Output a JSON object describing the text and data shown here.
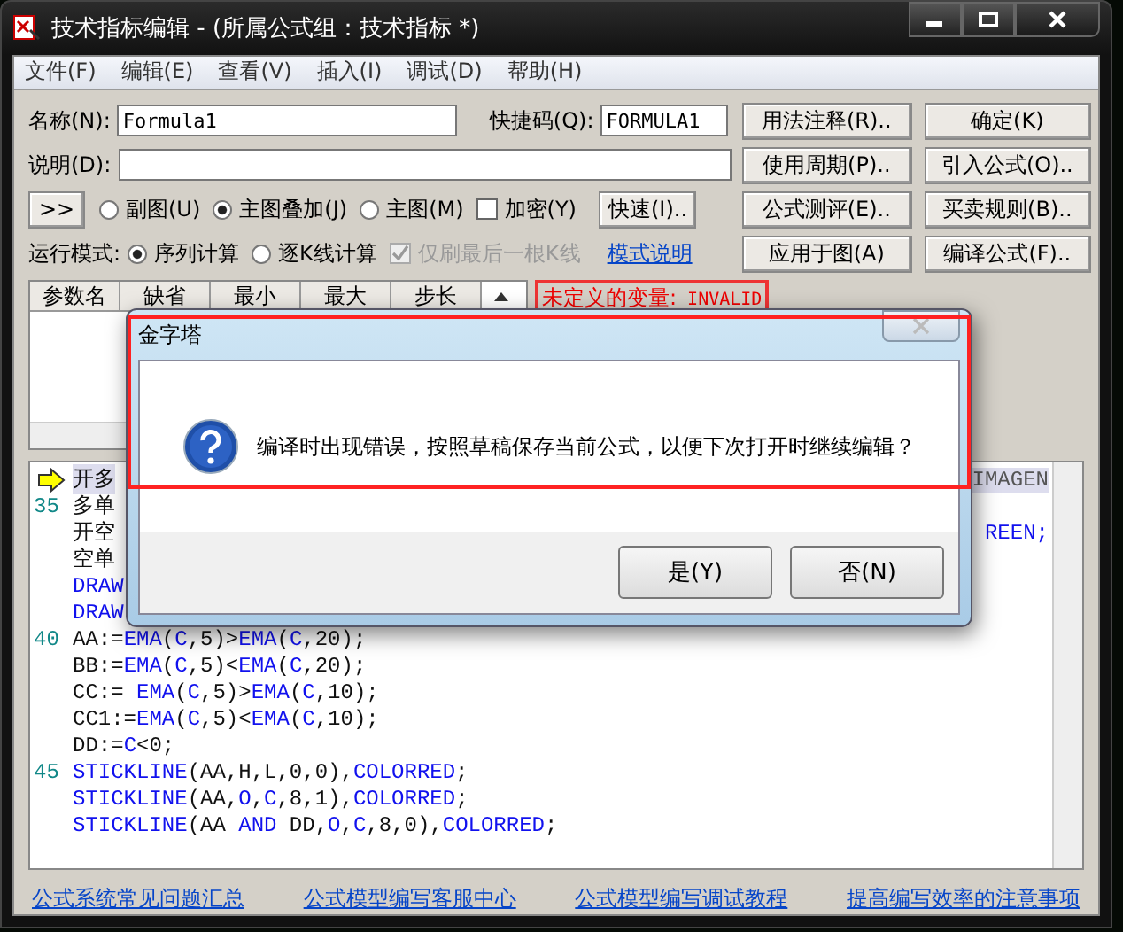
{
  "window": {
    "title": "技术指标编辑 - (所属公式组：技术指标 *)"
  },
  "menu": [
    "文件(F)",
    "编辑(E)",
    "查看(V)",
    "插入(I)",
    "调试(D)",
    "帮助(H)"
  ],
  "form": {
    "name_label": "名称(N):",
    "name_value": "Formula1",
    "shortcut_label": "快捷码(Q):",
    "shortcut_value": "FORMULA1",
    "desc_label": "说明(D):",
    "expand_button": ">>",
    "chart_options": [
      {
        "label": "副图(U)",
        "selected": false
      },
      {
        "label": "主图叠加(J)",
        "selected": true
      },
      {
        "label": "主图(M)",
        "selected": false
      }
    ],
    "encrypt": {
      "label": "加密(Y)",
      "checked": false
    },
    "quick_button": "快速(I)..",
    "run_mode_label": "运行模式:",
    "run_modes": [
      {
        "label": "序列计算",
        "selected": true
      },
      {
        "label": "逐K线计算",
        "selected": false
      }
    ],
    "refresh_last": {
      "label": "仅刷最后一根K线",
      "checked": true,
      "disabled": true
    },
    "mode_help_link": "模式说明"
  },
  "buttons": [
    [
      "用法注释(R)..",
      "确定(K)"
    ],
    [
      "使用周期(P)..",
      "引入公式(O).."
    ],
    [
      "公式测评(E)..",
      "买卖规则(B).."
    ],
    [
      "应用于图(A)",
      "编译公式(F).."
    ]
  ],
  "param_table": {
    "columns": [
      "参数名",
      "缺省",
      "最小",
      "最大",
      "步长"
    ]
  },
  "undefined_variable": {
    "label": "未定义的变量:",
    "value": "INVALID"
  },
  "code_lines": [
    {
      "current": true,
      "tokens": [
        {
          "text": "开多",
          "kind": "plain"
        }
      ],
      "tail": "IMAGEN"
    },
    {
      "number": "35",
      "current": false,
      "tokens": [
        {
          "text": "多单",
          "kind": "plain"
        }
      ]
    },
    {
      "current": false,
      "tokens": [
        {
          "text": "开空",
          "kind": "plain"
        }
      ],
      "tail": "REEN;"
    },
    {
      "current": false,
      "tokens": [
        {
          "text": "空单",
          "kind": "plain"
        }
      ]
    },
    {
      "current": false,
      "tokens": [
        {
          "text": "DRAW",
          "kind": "fn"
        }
      ]
    },
    {
      "current": false,
      "tokens": [
        {
          "text": "DRAW",
          "kind": "fn"
        }
      ]
    },
    {
      "number": "40",
      "current": false,
      "tokens": [
        {
          "text": "AA:=",
          "kind": "plain"
        },
        {
          "text": "EMA",
          "kind": "fn"
        },
        {
          "text": "(",
          "kind": "plain"
        },
        {
          "text": "C",
          "kind": "fn"
        },
        {
          "text": ",5)>",
          "kind": "plain"
        },
        {
          "text": "EMA",
          "kind": "fn"
        },
        {
          "text": "(",
          "kind": "plain"
        },
        {
          "text": "C",
          "kind": "fn"
        },
        {
          "text": ",20);",
          "kind": "plain"
        }
      ]
    },
    {
      "current": false,
      "tokens": [
        {
          "text": "BB:=",
          "kind": "plain"
        },
        {
          "text": "EMA",
          "kind": "fn"
        },
        {
          "text": "(",
          "kind": "plain"
        },
        {
          "text": "C",
          "kind": "fn"
        },
        {
          "text": ",5)<",
          "kind": "plain"
        },
        {
          "text": "EMA",
          "kind": "fn"
        },
        {
          "text": "(",
          "kind": "plain"
        },
        {
          "text": "C",
          "kind": "fn"
        },
        {
          "text": ",20);",
          "kind": "plain"
        }
      ]
    },
    {
      "current": false,
      "tokens": [
        {
          "text": "CC:= ",
          "kind": "plain"
        },
        {
          "text": "EMA",
          "kind": "fn"
        },
        {
          "text": "(",
          "kind": "plain"
        },
        {
          "text": "C",
          "kind": "fn"
        },
        {
          "text": ",5)>",
          "kind": "plain"
        },
        {
          "text": "EMA",
          "kind": "fn"
        },
        {
          "text": "(",
          "kind": "plain"
        },
        {
          "text": "C",
          "kind": "fn"
        },
        {
          "text": ",10);",
          "kind": "plain"
        }
      ]
    },
    {
      "current": false,
      "tokens": [
        {
          "text": "CC1:=",
          "kind": "plain"
        },
        {
          "text": "EMA",
          "kind": "fn"
        },
        {
          "text": "(",
          "kind": "plain"
        },
        {
          "text": "C",
          "kind": "fn"
        },
        {
          "text": ",5)<",
          "kind": "plain"
        },
        {
          "text": "EMA",
          "kind": "fn"
        },
        {
          "text": "(",
          "kind": "plain"
        },
        {
          "text": "C",
          "kind": "fn"
        },
        {
          "text": ",10);",
          "kind": "plain"
        }
      ]
    },
    {
      "current": false,
      "tokens": [
        {
          "text": "DD:=",
          "kind": "plain"
        },
        {
          "text": "C",
          "kind": "fn"
        },
        {
          "text": "<0;",
          "kind": "plain"
        }
      ]
    },
    {
      "number": "45",
      "current": false,
      "tokens": [
        {
          "text": "STICKLINE",
          "kind": "fn"
        },
        {
          "text": "(AA,H,L,0,0),",
          "kind": "plain"
        },
        {
          "text": "COLORRED",
          "kind": "fn"
        },
        {
          "text": ";",
          "kind": "plain"
        }
      ]
    },
    {
      "current": false,
      "tokens": [
        {
          "text": "STICKLINE",
          "kind": "fn"
        },
        {
          "text": "(AA,",
          "kind": "plain"
        },
        {
          "text": "O",
          "kind": "fn"
        },
        {
          "text": ",",
          "kind": "plain"
        },
        {
          "text": "C",
          "kind": "fn"
        },
        {
          "text": ",8,1),",
          "kind": "plain"
        },
        {
          "text": "COLORRED",
          "kind": "fn"
        },
        {
          "text": ";",
          "kind": "plain"
        }
      ]
    },
    {
      "current": false,
      "tokens": [
        {
          "text": "STICKLINE",
          "kind": "fn"
        },
        {
          "text": "(AA ",
          "kind": "plain"
        },
        {
          "text": "AND",
          "kind": "fn"
        },
        {
          "text": " DD,",
          "kind": "plain"
        },
        {
          "text": "O",
          "kind": "fn"
        },
        {
          "text": ",",
          "kind": "plain"
        },
        {
          "text": "C",
          "kind": "fn"
        },
        {
          "text": ",8,0),",
          "kind": "plain"
        },
        {
          "text": "COLORRED",
          "kind": "fn"
        },
        {
          "text": ";",
          "kind": "plain"
        }
      ]
    }
  ],
  "links": [
    "公式系统常见问题汇总",
    "公式模型编写客服中心",
    "公式模型编写调试教程",
    "提高编写效率的注意事项"
  ],
  "dialog": {
    "title": "金字塔",
    "message": "编译时出现错误，按照草稿保存当前公式，以便下次打开时继续编辑？",
    "buttons": [
      "是(Y)",
      "否(N)"
    ]
  }
}
